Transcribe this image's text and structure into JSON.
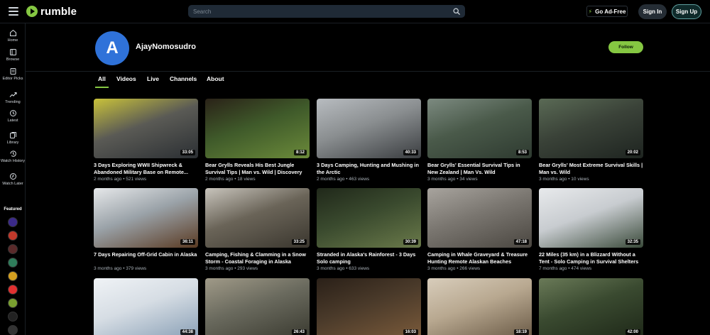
{
  "header": {
    "logo_text": "rumble",
    "search_placeholder": "Search",
    "go_ad_free": "Go Ad-Free",
    "sign_in": "Sign In",
    "sign_up": "Sign Up"
  },
  "sidebar": {
    "items": [
      {
        "label": "Home",
        "icon": "home-icon"
      },
      {
        "label": "Browse",
        "icon": "browse-icon"
      },
      {
        "label": "Editor Picks",
        "icon": "editor-picks-icon"
      },
      {
        "label": "Trending",
        "icon": "trending-icon"
      },
      {
        "label": "Latest",
        "icon": "latest-icon"
      },
      {
        "label": "Library",
        "icon": "library-icon"
      },
      {
        "label": "Watch History",
        "icon": "history-icon"
      },
      {
        "label": "Watch Later",
        "icon": "watch-later-icon"
      }
    ],
    "featured_label": "Featured",
    "featured_colors": [
      "#3b2a8a",
      "#c0392b",
      "#5a2a2a",
      "#2f7d5b",
      "#d4a020",
      "#e03030",
      "#7aa030",
      "#222222",
      "#333333"
    ]
  },
  "channel": {
    "avatar_letter": "A",
    "name": "AjayNomosudro",
    "follow_label": "Follow"
  },
  "tabs": [
    "All",
    "Videos",
    "Live",
    "Channels",
    "About"
  ],
  "active_tab": "All",
  "videos": [
    {
      "title": "3 Days Exploring WWII Shipwreck & Abandoned Military Base on Remote...",
      "age": "2 months ago",
      "views": "521 views",
      "duration": "33:05"
    },
    {
      "title": "Bear Grylls Reveals His Best Jungle Survival Tips | Man vs. Wild | Discovery",
      "age": "2 months ago",
      "views": "18 views",
      "duration": "8:12"
    },
    {
      "title": "3 Days Camping, Hunting and Mushing in the Arctic",
      "age": "2 months ago",
      "views": "463 views",
      "duration": "40:33"
    },
    {
      "title": "Bear Grylls' Essential Survival Tips in New Zealand | Man Vs. Wild",
      "age": "3 months ago",
      "views": "34 views",
      "duration": "8:53"
    },
    {
      "title": "Bear Grylls' Most Extreme Survival Skills | Man vs. Wild",
      "age": "3 months ago",
      "views": "10 views",
      "duration": "20:02"
    },
    {
      "title": "7 Days Repairing Off-Grid Cabin in Alaska",
      "age": "3 months ago",
      "views": "379 views",
      "duration": "36:11"
    },
    {
      "title": "Camping, Fishing & Clamming in a Snow Storm - Coastal Foraging in Alaska",
      "age": "3 months ago",
      "views": "293 views",
      "duration": "33:25"
    },
    {
      "title": "Stranded in Alaska's Rainforest - 3 Days Solo camping",
      "age": "3 months ago",
      "views": "633 views",
      "duration": "30:39"
    },
    {
      "title": "Camping in Whale Graveyard & Treasure Hunting Remote Alaskan Beaches",
      "age": "3 months ago",
      "views": "266 views",
      "duration": "47:18"
    },
    {
      "title": "22 Miles (35 km) in a Blizzard Without a Tent - Solo Camping in Survival Shelters",
      "age": "7 months ago",
      "views": "474 views",
      "duration": "32:35"
    },
    {
      "title": "",
      "age": "",
      "views": "",
      "duration": "44:38"
    },
    {
      "title": "",
      "age": "",
      "views": "",
      "duration": "26:43"
    },
    {
      "title": "",
      "age": "",
      "views": "",
      "duration": "16:03"
    },
    {
      "title": "",
      "age": "",
      "views": "",
      "duration": "18:19"
    },
    {
      "title": "",
      "age": "",
      "views": "",
      "duration": "42:00"
    }
  ],
  "thumb_palettes": [
    [
      "#5a5a55",
      "#2b2f33",
      "#c9c23a"
    ],
    [
      "#3f5a2a",
      "#6b8a3a",
      "#2a2218"
    ],
    [
      "#8a8e90",
      "#3a3d40",
      "#b8bcc0"
    ],
    [
      "#4a5a4a",
      "#2e3a30",
      "#7c8a80"
    ],
    [
      "#3a4238",
      "#1e2420",
      "#5a6a55"
    ],
    [
      "#9aa2a8",
      "#5a3a22",
      "#e6e8ea"
    ],
    [
      "#6a6458",
      "#3a362e",
      "#c8c4bc"
    ],
    [
      "#3a4a2e",
      "#6a7a4a",
      "#20281a"
    ],
    [
      "#7a7670",
      "#4a4640",
      "#a8a49e"
    ],
    [
      "#c8ccd0",
      "#3a4a3a",
      "#e8eaec"
    ],
    [
      "#d6dde4",
      "#8aa0b6",
      "#f0f3f6"
    ],
    [
      "#6a6a5e",
      "#3a3a30",
      "#a09a88"
    ],
    [
      "#4a3a2a",
      "#7a5a3a",
      "#2a2018"
    ],
    [
      "#b8a890",
      "#6a5a46",
      "#d8cdbb"
    ],
    [
      "#3a4a30",
      "#1e2818",
      "#6a7a58"
    ]
  ],
  "brand_color": "#85c742"
}
